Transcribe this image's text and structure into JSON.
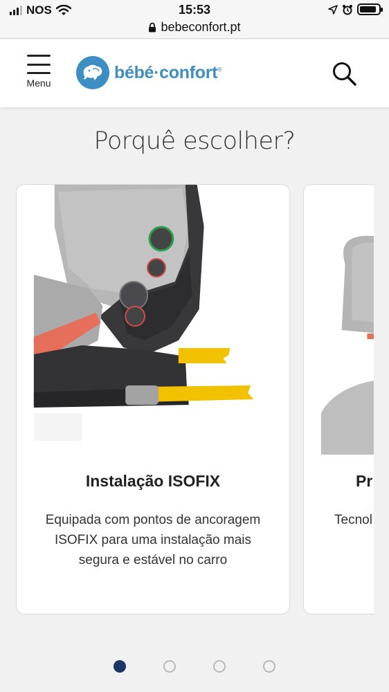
{
  "status_bar": {
    "carrier": "NOS",
    "time": "15:53",
    "url": "bebeconfort.pt",
    "battery_level": 0.9
  },
  "header": {
    "menu_label": "Menu",
    "logo_text": "bébé·confort",
    "logo_mark": "®"
  },
  "section": {
    "title": "Porquê escolher?"
  },
  "cards": [
    {
      "title": "Instalação ISOFIX",
      "text": "Equipada com pontos de ancoragem ISOFIX para uma instalação mais segura e estável no carro"
    },
    {
      "title": "Pr",
      "text": "Tecnol par"
    }
  ],
  "pagination": {
    "count": 4,
    "active_index": 0
  },
  "icons": {
    "signal": "signal-icon",
    "wifi": "wifi-icon",
    "lock": "lock-icon",
    "location": "location-arrow-icon",
    "alarm": "alarm-clock-icon",
    "battery": "battery-icon",
    "menu": "hamburger-menu-icon",
    "search": "search-icon"
  },
  "colors": {
    "brand_blue": "#3d8ec3",
    "dot_active": "#1d3467",
    "isofix_yellow": "#f2c200"
  }
}
